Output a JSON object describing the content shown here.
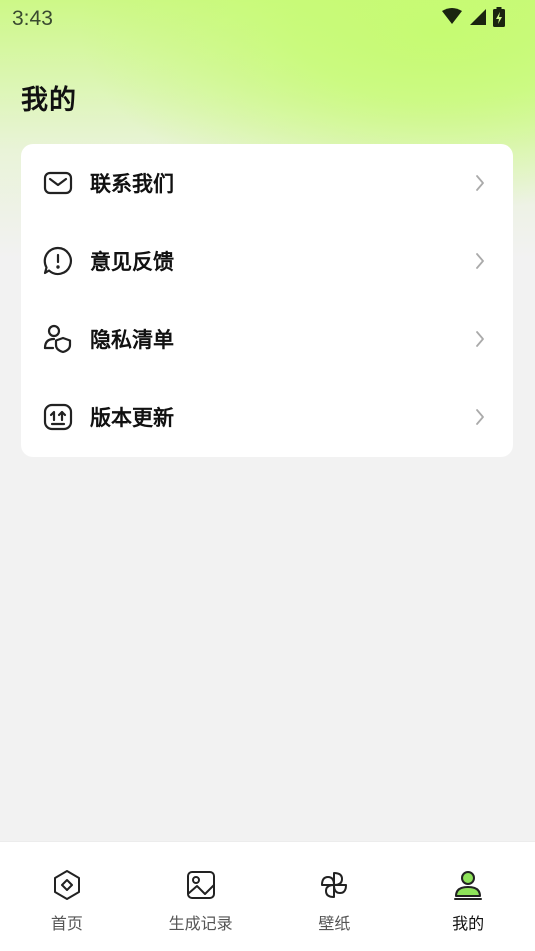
{
  "status_bar": {
    "time": "3:43",
    "icons": [
      "wifi-icon",
      "cellular-signal-icon",
      "battery-charging-icon"
    ]
  },
  "page": {
    "title": "我的"
  },
  "colors": {
    "accent_green": "#8ee35a",
    "gradient_green": "#c6fb72",
    "background": "#f2f2f2",
    "card": "#ffffff"
  },
  "menu": {
    "items": [
      {
        "label": "联系我们",
        "icon": "mail-icon"
      },
      {
        "label": "意见反馈",
        "icon": "feedback-icon"
      },
      {
        "label": "隐私清单",
        "icon": "privacy-icon"
      },
      {
        "label": "版本更新",
        "icon": "update-icon"
      }
    ]
  },
  "bottom_nav": {
    "items": [
      {
        "label": "首页",
        "icon": "home-icon"
      },
      {
        "label": "生成记录",
        "icon": "image-icon"
      },
      {
        "label": "壁纸",
        "icon": "pinwheel-icon"
      },
      {
        "label": "我的",
        "icon": "profile-icon"
      }
    ],
    "active": "我的"
  }
}
